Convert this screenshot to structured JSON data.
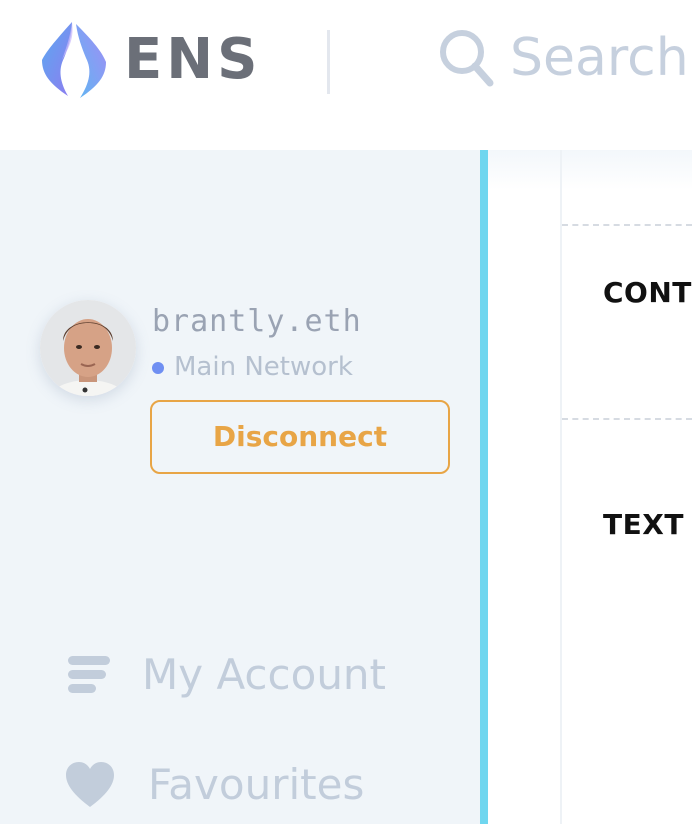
{
  "header": {
    "logo_text": "ENS",
    "search_label": "Search"
  },
  "sidebar": {
    "account": {
      "name": "brantly.eth",
      "network": "Main Network",
      "disconnect_label": "Disconnect"
    },
    "nav": [
      {
        "label": "My Account",
        "icon": "my-account-icon"
      },
      {
        "label": "Favourites",
        "icon": "heart-icon"
      }
    ]
  },
  "main": {
    "sections": [
      {
        "label": "CONTENT"
      },
      {
        "label": "TEXT RECORDS"
      }
    ]
  },
  "colors": {
    "accent_orange": "#e8a546",
    "sidebar_bg": "#f0f5f9",
    "sidebar_accent": "#6fd6ef",
    "network_dot": "#6f8ff2",
    "muted_text": "#c2cddb"
  }
}
